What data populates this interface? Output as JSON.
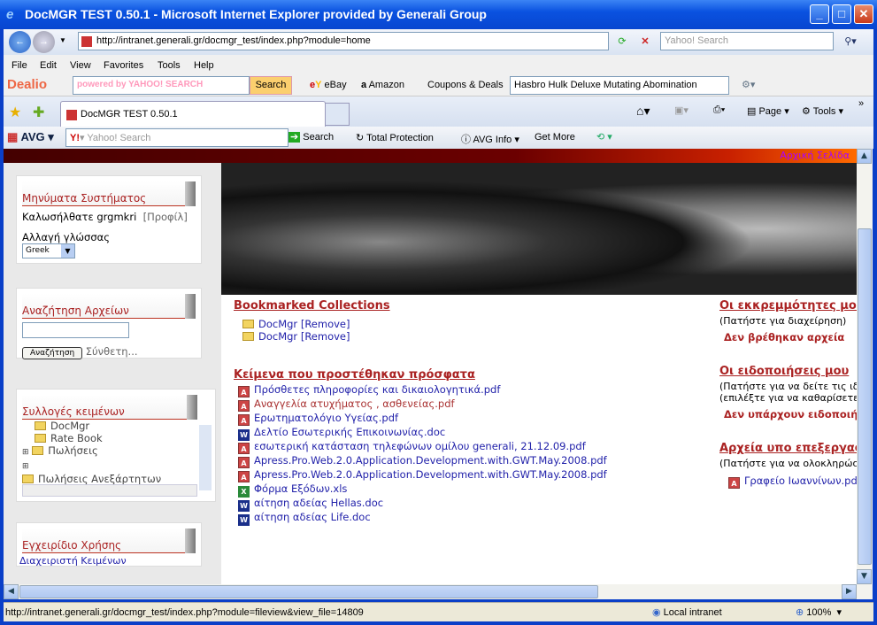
{
  "window": {
    "title": "DocMGR TEST 0.50.1 - Microsoft Internet Explorer provided by Generali Group"
  },
  "address": {
    "url": "http://intranet.generali.gr/docmgr_test/index.php?module=home",
    "search_placeholder": "Yahoo! Search"
  },
  "menu": [
    "File",
    "Edit",
    "View",
    "Favorites",
    "Tools",
    "Help"
  ],
  "dealio": {
    "brand": "Dealio",
    "search_placeholder": "powered by YAHOO! SEARCH",
    "search_label": "Search",
    "ebay": "eBay",
    "amazon": "Amazon",
    "coupons": "Coupons & Deals",
    "deal_value": "Hasbro Hulk Deluxe Mutating Abomination"
  },
  "tabs": {
    "active": "DocMGR TEST 0.50.1",
    "page": "Page",
    "tools": "Tools"
  },
  "avg": {
    "brand": "AVG",
    "search_placeholder": "Yahoo! Search",
    "search_label": "Search",
    "total_protection": "Total Protection",
    "info": "AVG Info",
    "get_more": "Get More"
  },
  "banner": {
    "home_link": "Αρχική Σελίδα"
  },
  "sidebar": {
    "system": {
      "title": "Μηνύματα Συστήματος",
      "welcome": "Καλωσήλθατε grgmkri",
      "profile": "[Προφίλ]",
      "language_label": "Αλλαγή γλώσσας",
      "language_value": "Greek"
    },
    "search": {
      "title": "Αναζήτηση Αρχείων",
      "input_value": "",
      "button": "Αναζήτηση",
      "advanced": "Σύνθετη..."
    },
    "collections": {
      "title": "Συλλογές κειμένων",
      "items": [
        "DocMgr",
        "Rate Book",
        "Πωλήσεις",
        "Πωλήσεις Ανεξάρτητων Δικτύων"
      ]
    },
    "manual": {
      "title": "Εγχειρίδιο Χρήσης",
      "link": "Διαχειριστή Κειμένων"
    }
  },
  "main": {
    "bookmarks": {
      "title": "Bookmarked Collections",
      "items": [
        {
          "name": "DocMgr",
          "action": "[Remove]"
        },
        {
          "name": "DocMgr",
          "action": "[Remove]"
        }
      ]
    },
    "recent": {
      "title": "Κείμενα που προστέθηκαν πρόσφατα",
      "items": [
        {
          "name": "Πρόσθετες πληροφορίες και δικαιολογητικά.pdf",
          "type": "pdf"
        },
        {
          "name": "Αναγγελία ατυχήματος , ασθενείας.pdf",
          "type": "pdf",
          "visited": true
        },
        {
          "name": "Ερωτηματολόγιο Υγείας.pdf",
          "type": "pdf"
        },
        {
          "name": "Δελτίο Εσωτερικής Επικοινωνίας.doc",
          "type": "doc"
        },
        {
          "name": "εσωτερική κατάσταση τηλεφώνων ομίλου generali, 21.12.09.pdf",
          "type": "pdf"
        },
        {
          "name": "Apress.Pro.Web.2.0.Application.Development.with.GWT.May.2008.pdf",
          "type": "pdf"
        },
        {
          "name": "Apress.Pro.Web.2.0.Application.Development.with.GWT.May.2008.pdf",
          "type": "pdf"
        },
        {
          "name": "Φόρμα Εξόδων.xls",
          "type": "xls"
        },
        {
          "name": "αίτηση αδείας Hellas.doc",
          "type": "doc"
        },
        {
          "name": "αίτηση αδείας Life.doc",
          "type": "doc"
        }
      ]
    },
    "pending": {
      "title": "Οι εκκρεμμότητες μου",
      "hint": "(Πατήστε για διαχείρηση)",
      "empty": "Δεν βρέθηκαν αρχεία"
    },
    "notifications": {
      "title": "Οι ειδοποιήσεις μου",
      "hint1": "(Πατήστε για να δείτε τις ιδιό",
      "hint2": "(επιλέξτε για να καθαρίσετε τ",
      "empty": "Δεν υπάρχουν ειδοποιήσ"
    },
    "checkedout": {
      "title": "Αρχεία υπο επεξεργασ",
      "hint": "(Πατήστε για να ολοκληρώσε",
      "items": [
        "Γραφείο Ιωαννίνων.pdf"
      ]
    }
  },
  "status": {
    "url": "http://intranet.generali.gr/docmgr_test/index.php?module=fileview&view_file=14809",
    "zone": "Local intranet",
    "zoom": "100%"
  }
}
